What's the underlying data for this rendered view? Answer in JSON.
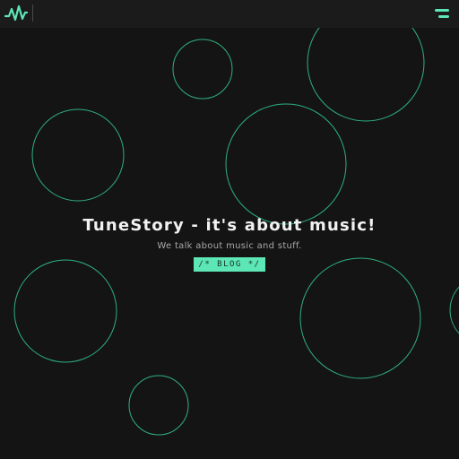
{
  "header": {
    "logo_icon": "soundwave-logo-icon",
    "menu_icon": "hamburger-menu-icon"
  },
  "hero": {
    "title": "TuneStory - it's about music!",
    "subtitle": "We talk about music and stuff.",
    "button_label": "/* BLOG */"
  },
  "colors": {
    "background": "#141414",
    "topbar": "#1b1b1b",
    "accent": "#5de6b6",
    "circle_stroke": "#2fb07f",
    "title": "#f2f2f2",
    "subtitle": "#a9a9a9"
  }
}
